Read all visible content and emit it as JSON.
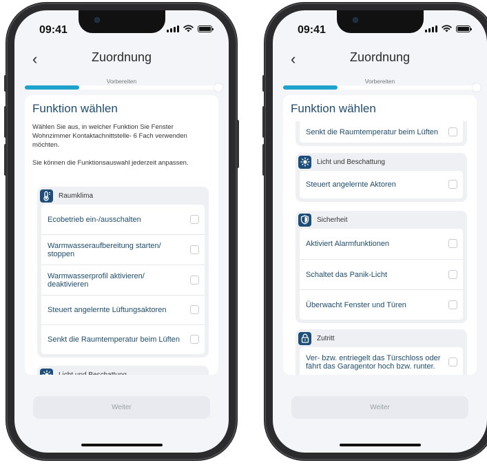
{
  "status_bar": {
    "time": "09:41"
  },
  "header": {
    "title": "Zuordnung",
    "back_label": "‹"
  },
  "progress": {
    "step_label": "Vorbereiten",
    "fraction": 0.28
  },
  "card": {
    "title": "Funktion wählen",
    "intro_1": "Wählen Sie aus, in welcher Funktion Sie Fenster Wohnzimmer  Kontaktachnittstelle- 6 Fach verwenden möchten.",
    "intro_2": "Sie können die Funktionsauswahl jederzeit anpassen."
  },
  "groups": {
    "raumklima": {
      "label": "Raumklima",
      "items": [
        "Ecobetrieb ein-/ausschalten",
        "Warmwasseraufbereitung starten/ stoppen",
        "Warmwasserprofil aktivieren/ deaktivieren",
        "Steuert angelernte Lüftungsaktoren",
        "Senkt die Raumtemperatur beim Lüften"
      ]
    },
    "licht": {
      "label": "Licht und Beschattung",
      "items": [
        "Steuert angelernte Aktoren"
      ]
    },
    "sicherheit": {
      "label": "Sicherheit",
      "items": [
        "Aktiviert Alarmfunktionen",
        "Schaltet das Panik-Licht",
        "Überwacht Fenster und Türen"
      ]
    },
    "zutritt": {
      "label": "Zutritt",
      "items": [
        "Ver- bzw. entriegelt das Türschloss oder fährt das Garagentor hoch bzw. runter."
      ]
    }
  },
  "footer": {
    "next_label": "Weiter"
  },
  "colors": {
    "accent": "#1fa3cc",
    "primary_text": "#1e4c6e",
    "icon_bg": "#1d4e79"
  }
}
